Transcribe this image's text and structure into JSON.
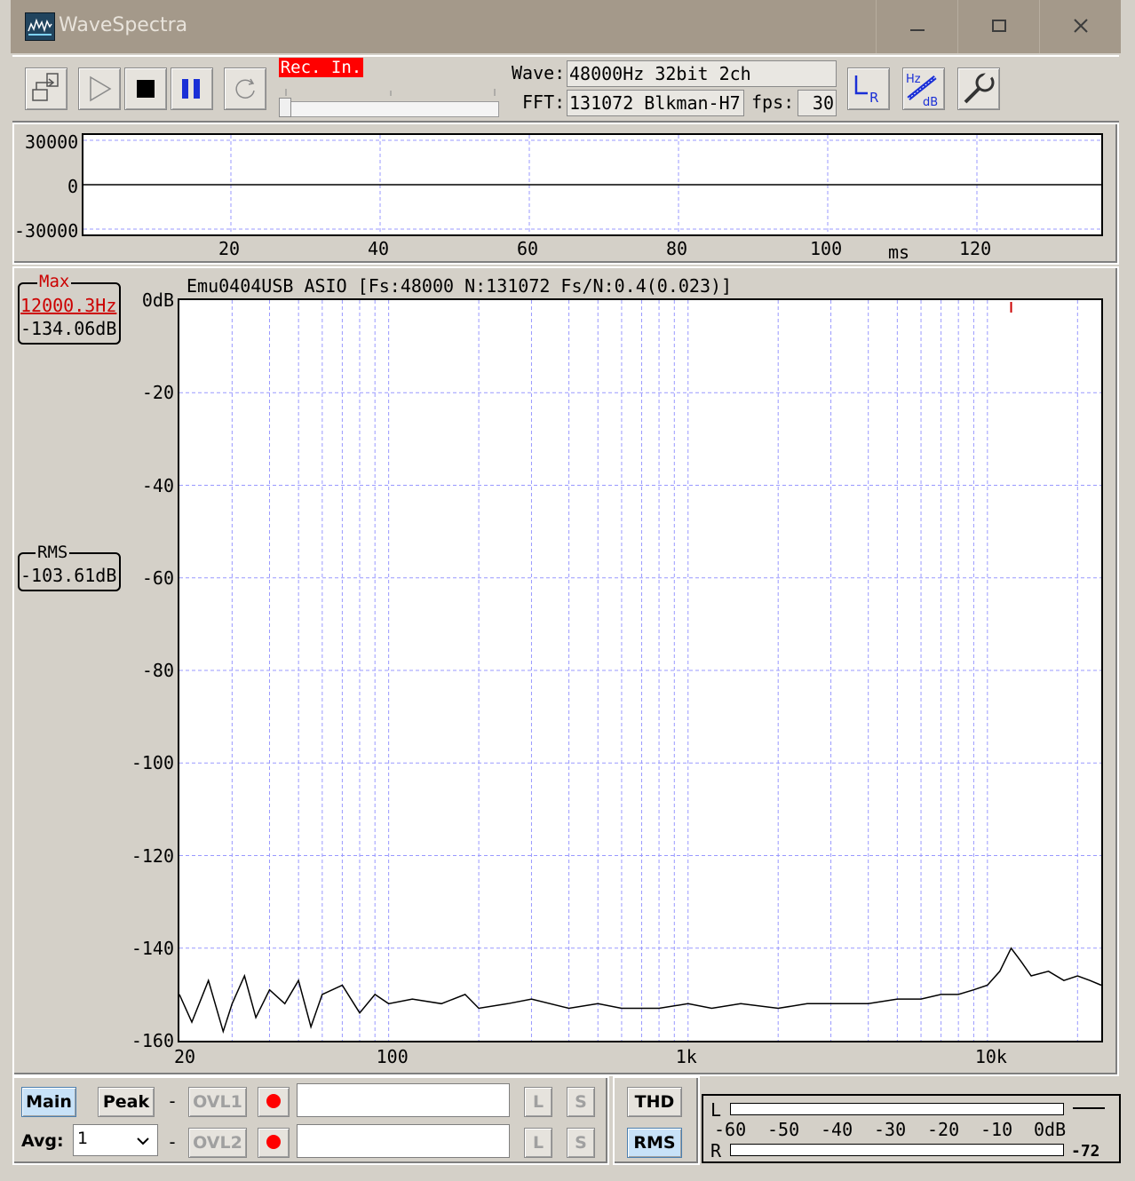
{
  "window": {
    "title": "WaveSpectra",
    "minimize_icon": "minimize-icon",
    "maximize_icon": "maximize-icon",
    "close_icon": "close-icon"
  },
  "toolbar": {
    "status_label": "Rec. In.",
    "wave_label": "Wave:",
    "wave_value": "48000Hz 32bit 2ch",
    "fft_label": "FFT:",
    "fft_value": "131072 Blkman-H7",
    "fps_label": "fps:",
    "fps_value": "30",
    "buttons": [
      "open-icon",
      "play-icon",
      "stop-icon",
      "pause-icon",
      "repeat-icon",
      "lr-icon",
      "hz-db-icon",
      "settings-wrench-icon"
    ]
  },
  "waveform": {
    "yticks": [
      "30000",
      "0",
      "-30000"
    ],
    "xticks": [
      "20",
      "40",
      "60",
      "80",
      "100",
      "120"
    ],
    "xunit": "ms"
  },
  "spectrum": {
    "header": "Emu0404USB ASIO   [Fs:48000 N:131072 Fs/N:0.4(0.023)]",
    "max_label": "Max",
    "max_freq": "12000.3Hz",
    "max_level": "-134.06dB",
    "rms_label": "RMS",
    "rms_level": "-103.61dB",
    "yticks": [
      "0dB",
      "-20",
      "-40",
      "-60",
      "-80",
      "-100",
      "-120",
      "-140",
      "-160"
    ],
    "xticks": [
      "20",
      "100",
      "1k",
      "10k"
    ]
  },
  "bottom": {
    "main_label": "Main",
    "peak_label": "Peak",
    "dash1": "-",
    "dash2": "-",
    "ovl1_label": "OVL1",
    "ovl2_label": "OVL2",
    "l_label": "L",
    "s_label": "S",
    "thd_label": "THD",
    "rms_label": "RMS",
    "avg_label": "Avg:",
    "avg_value": "1"
  },
  "meter": {
    "l_label": "L",
    "r_label": "R",
    "scale": [
      "-60",
      "-50",
      "-40",
      "-30",
      "-20",
      "-10",
      "0dB"
    ],
    "r_readout": "-72"
  },
  "colors": {
    "peak_marker": "#cc0000",
    "grid": "#9999ff",
    "rec_bg": "#ff0000",
    "selected_button": "#c8e2f8"
  },
  "chart_data": {
    "type": "line",
    "title": "",
    "xlabel": "",
    "ylabel": "",
    "xscale": "log",
    "xlim": [
      20,
      24000
    ],
    "ylim": [
      -160,
      0
    ],
    "grid": true,
    "series": [
      {
        "x": [
          20,
          22,
          25,
          28,
          30,
          33,
          36,
          40,
          45,
          50,
          55,
          60,
          70,
          80,
          90,
          100,
          120,
          150,
          180,
          200,
          250,
          300,
          400,
          500,
          600,
          800,
          1000,
          1200,
          1500,
          2000,
          2500,
          3000,
          4000,
          5000,
          6000,
          7000,
          8000,
          9000,
          10000,
          11000,
          12000,
          13000,
          14000,
          16000,
          18000,
          20000,
          22000,
          24000
        ],
        "y": [
          -150,
          -156,
          -147,
          -158,
          -152,
          -146,
          -155,
          -149,
          -152,
          -147,
          -157,
          -150,
          -148,
          -154,
          -150,
          -152,
          -151,
          -152,
          -150,
          -153,
          -152,
          -151,
          -153,
          -152,
          -153,
          -153,
          -152,
          -153,
          -152,
          -153,
          -152,
          -152,
          -152,
          -151,
          -151,
          -150,
          -150,
          -149,
          -148,
          -145,
          -140,
          -143,
          -146,
          -145,
          -147,
          -146,
          -147,
          -148
        ]
      }
    ],
    "marker": {
      "x": 12000.3,
      "y": -134.06
    }
  }
}
